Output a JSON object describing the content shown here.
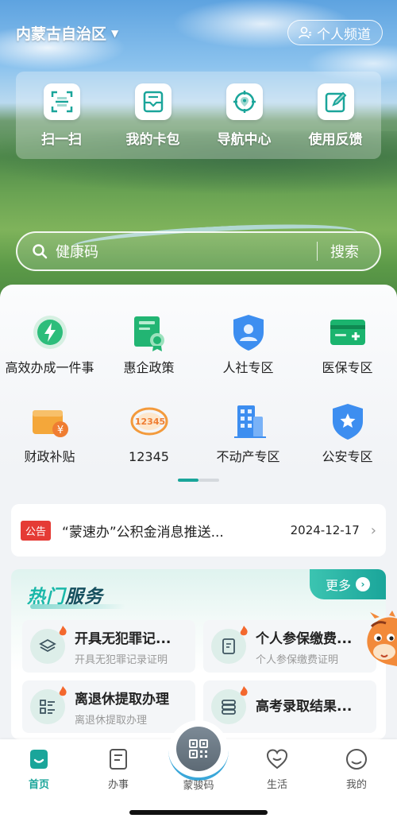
{
  "header": {
    "region": "内蒙古自治区",
    "personal_channel": "个人频道"
  },
  "quick_actions": [
    {
      "label": "扫一扫",
      "icon": "scan-icon"
    },
    {
      "label": "我的卡包",
      "icon": "card-wallet-icon"
    },
    {
      "label": "导航中心",
      "icon": "navigation-icon"
    },
    {
      "label": "使用反馈",
      "icon": "feedback-icon"
    }
  ],
  "search": {
    "text": "健康码",
    "button": "搜索"
  },
  "services": [
    {
      "label": "高效办成一件事",
      "icon": "lightning-icon"
    },
    {
      "label": "惠企政策",
      "icon": "certificate-icon"
    },
    {
      "label": "人社专区",
      "icon": "social-security-shield-icon"
    },
    {
      "label": "医保专区",
      "icon": "medical-card-icon"
    },
    {
      "label": "财政补贴",
      "icon": "wallet-yuan-icon"
    },
    {
      "label": "12345",
      "icon": "hotline-12345-icon"
    },
    {
      "label": "不动产专区",
      "icon": "building-icon"
    },
    {
      "label": "公安专区",
      "icon": "police-shield-icon"
    }
  ],
  "notice": {
    "tag": "公告",
    "text": "“蒙速办”公积金消息推送...",
    "date": "2024-12-17"
  },
  "hot_services": {
    "title_a": "热门",
    "title_b": "服务",
    "more": "更多",
    "items": [
      {
        "title": "开具无犯罪记...",
        "subtitle": "开具无犯罪记录证明",
        "icon": "layers-icon"
      },
      {
        "title": "个人参保缴费...",
        "subtitle": "个人参保缴费证明",
        "icon": "document-badge-icon"
      },
      {
        "title": "离退休提取办理",
        "subtitle": "离退休提取办理",
        "icon": "grid-list-icon"
      },
      {
        "title": "高考录取结果...",
        "subtitle": "",
        "icon": "database-icon"
      }
    ]
  },
  "tabbar": {
    "home": "首页",
    "affairs": "办事",
    "center": "蒙骏码",
    "life": "生活",
    "mine": "我的"
  },
  "colors": {
    "accent": "#1aa59a",
    "notice_tag": "#e53b35"
  }
}
